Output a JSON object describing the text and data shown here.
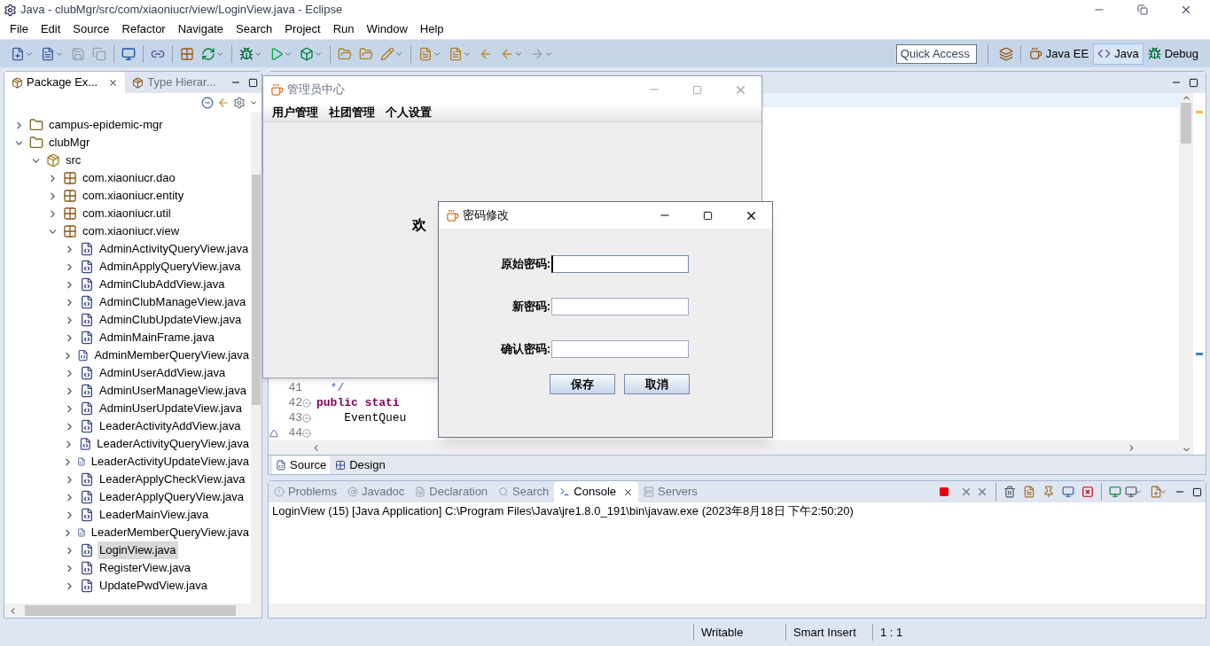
{
  "window": {
    "title": "Java - clubMgr/src/com/xiaoniucr/view/LoginView.java - Eclipse"
  },
  "menu": [
    "File",
    "Edit",
    "Source",
    "Refactor",
    "Navigate",
    "Search",
    "Project",
    "Run",
    "Window",
    "Help"
  ],
  "quick_access": {
    "placeholder": "Quick Access"
  },
  "perspectives": [
    {
      "label": "Java EE",
      "selected": false
    },
    {
      "label": "Java",
      "selected": true
    },
    {
      "label": "Debug",
      "selected": false
    }
  ],
  "explorer": {
    "tabs": [
      {
        "label": "Package Ex...",
        "selected": true
      },
      {
        "label": "Type Hierar...",
        "selected": false
      }
    ],
    "tree": [
      {
        "label": "campus-epidemic-mgr",
        "kind": "project",
        "expanded": false,
        "selected": false
      },
      {
        "label": "clubMgr",
        "kind": "project",
        "expanded": true,
        "selected": false,
        "children": [
          {
            "label": "src",
            "kind": "folder",
            "expanded": true,
            "selected": false,
            "children": [
              {
                "label": "com.xiaoniucr.dao",
                "kind": "package",
                "expanded": false,
                "selected": false
              },
              {
                "label": "com.xiaoniucr.entity",
                "kind": "package",
                "expanded": false,
                "selected": false
              },
              {
                "label": "com.xiaoniucr.util",
                "kind": "package",
                "expanded": false,
                "selected": false
              },
              {
                "label": "com.xiaoniucr.view",
                "kind": "package",
                "expanded": true,
                "selected": false,
                "children": [
                  {
                    "label": "AdminActivityQueryView.java",
                    "kind": "java",
                    "expanded": false,
                    "selected": false
                  },
                  {
                    "label": "AdminApplyQueryView.java",
                    "kind": "java",
                    "expanded": false,
                    "selected": false
                  },
                  {
                    "label": "AdminClubAddView.java",
                    "kind": "java",
                    "expanded": false,
                    "selected": false
                  },
                  {
                    "label": "AdminClubManageView.java",
                    "kind": "java",
                    "expanded": false,
                    "selected": false
                  },
                  {
                    "label": "AdminClubUpdateView.java",
                    "kind": "java",
                    "expanded": false,
                    "selected": false
                  },
                  {
                    "label": "AdminMainFrame.java",
                    "kind": "java",
                    "expanded": false,
                    "selected": false
                  },
                  {
                    "label": "AdminMemberQueryView.java",
                    "kind": "java",
                    "expanded": false,
                    "selected": false
                  },
                  {
                    "label": "AdminUserAddView.java",
                    "kind": "java",
                    "expanded": false,
                    "selected": false
                  },
                  {
                    "label": "AdminUserManageView.java",
                    "kind": "java",
                    "expanded": false,
                    "selected": false
                  },
                  {
                    "label": "AdminUserUpdateView.java",
                    "kind": "java",
                    "expanded": false,
                    "selected": false
                  },
                  {
                    "label": "LeaderActivityAddView.java",
                    "kind": "java",
                    "expanded": false,
                    "selected": false
                  },
                  {
                    "label": "LeaderActivityQueryView.java",
                    "kind": "java",
                    "expanded": false,
                    "selected": false
                  },
                  {
                    "label": "LeaderActivityUpdateView.java",
                    "kind": "java",
                    "expanded": false,
                    "selected": false
                  },
                  {
                    "label": "LeaderApplyCheckView.java",
                    "kind": "java",
                    "expanded": false,
                    "selected": false
                  },
                  {
                    "label": "LeaderApplyQueryView.java",
                    "kind": "java",
                    "expanded": false,
                    "selected": false
                  },
                  {
                    "label": "LeaderMainView.java",
                    "kind": "java",
                    "expanded": false,
                    "selected": false
                  },
                  {
                    "label": "LeaderMemberQueryView.java",
                    "kind": "java",
                    "expanded": false,
                    "selected": false
                  },
                  {
                    "label": "LoginView.java",
                    "kind": "java",
                    "expanded": false,
                    "selected": true
                  },
                  {
                    "label": "RegisterView.java",
                    "kind": "java",
                    "expanded": false,
                    "selected": false
                  },
                  {
                    "label": "UpdatePwdView.java",
                    "kind": "java",
                    "expanded": false,
                    "selected": false
                  }
                ]
              }
            ]
          }
        ]
      }
    ]
  },
  "editor": {
    "lines": [
      {
        "number": "41",
        "fold": false,
        "override_marker": false,
        "tokens": [
          {
            "text": "  */",
            "kind": "comment"
          }
        ]
      },
      {
        "number": "42",
        "fold": true,
        "override_marker": false,
        "tokens": [
          {
            "text": "public stati",
            "kind": "keyword"
          }
        ]
      },
      {
        "number": "43",
        "fold": true,
        "override_marker": false,
        "tokens": [
          {
            "text": "    EventQueu",
            "kind": "plain"
          }
        ]
      },
      {
        "number": "44",
        "fold": true,
        "override_marker": true
      }
    ],
    "bottom_tabs": [
      {
        "label": "Source",
        "selected": true
      },
      {
        "label": "Design",
        "selected": false
      }
    ]
  },
  "admin_window": {
    "title": "管理员中心",
    "menu": [
      "用户管理",
      "社团管理",
      "个人设置"
    ],
    "welcome": "欢"
  },
  "password_dialog": {
    "title": "密码修改",
    "fields": [
      {
        "label": "原始密码:",
        "focused": true
      },
      {
        "label": "新密码:",
        "focused": false
      },
      {
        "label": "确认密码:",
        "focused": false
      }
    ],
    "buttons": [
      "保存",
      "取消"
    ]
  },
  "console": {
    "tabs": [
      {
        "label": "Problems",
        "selected": false
      },
      {
        "label": "Javadoc",
        "selected": false
      },
      {
        "label": "Declaration",
        "selected": false
      },
      {
        "label": "Search",
        "selected": false
      },
      {
        "label": "Console",
        "selected": true
      },
      {
        "label": "Servers",
        "selected": false
      }
    ],
    "launch": "LoginView (15) [Java Application] C:\\Program Files\\Java\\jre1.8.0_191\\bin\\javaw.exe (2023年8月18日 下午2:50:20)"
  },
  "status_bar": [
    "Writable",
    "Smart Insert",
    "1 : 1"
  ]
}
